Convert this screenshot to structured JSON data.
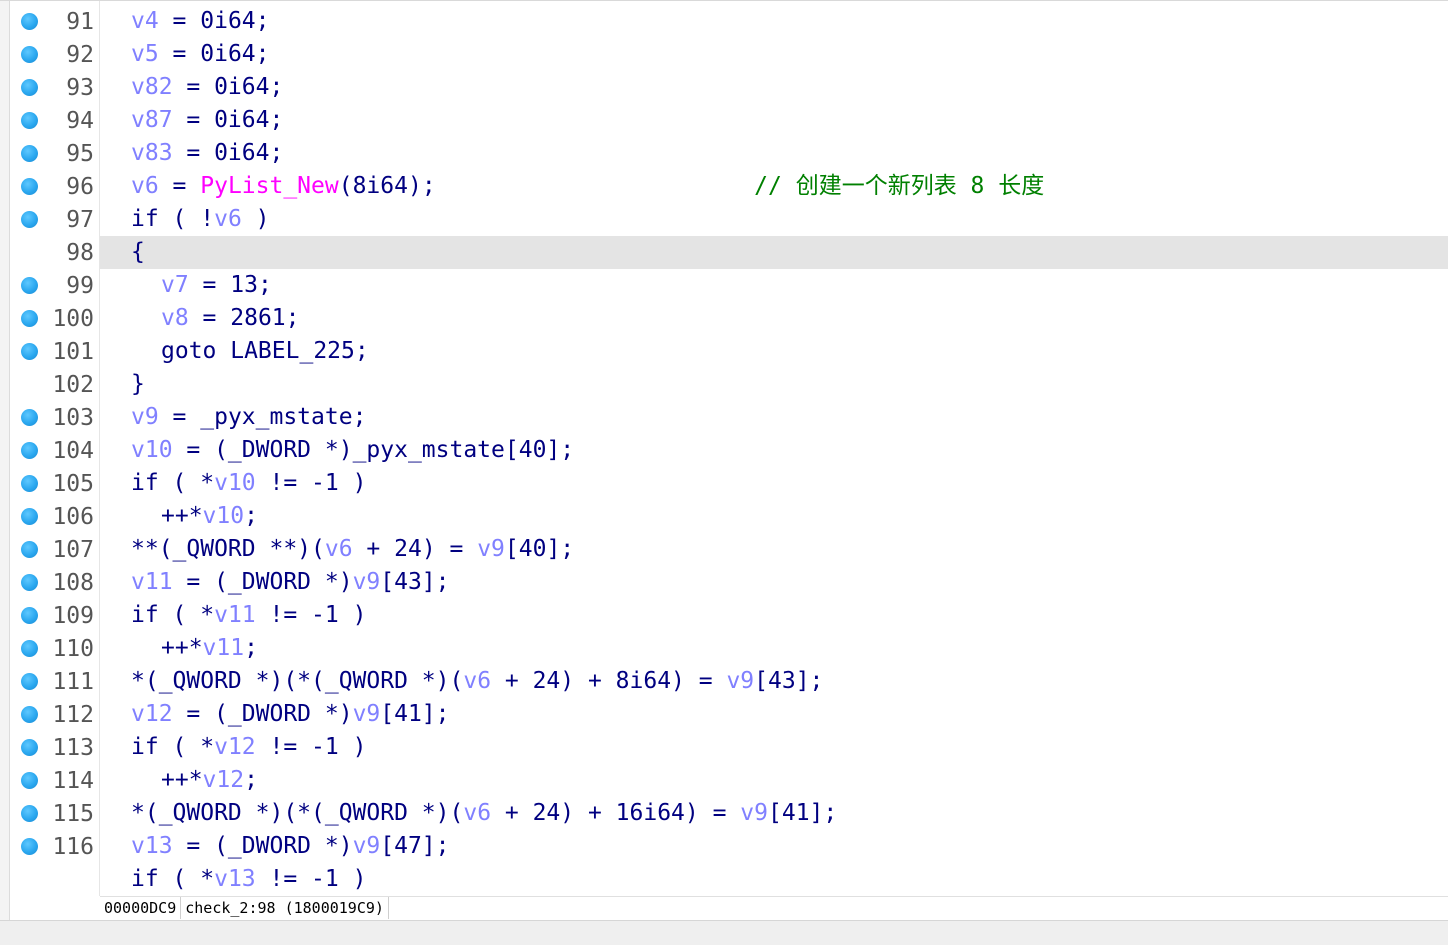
{
  "colors": {
    "variable": "#8080ff",
    "keyword": "#000080",
    "function": "#ff00ff",
    "comment": "#008000",
    "breakpoint": "#2aa7ef",
    "current_line_bg": "#e4e4e4"
  },
  "gutter": [
    {
      "num": "91",
      "bp": true
    },
    {
      "num": "92",
      "bp": true
    },
    {
      "num": "93",
      "bp": true
    },
    {
      "num": "94",
      "bp": true
    },
    {
      "num": "95",
      "bp": true
    },
    {
      "num": "96",
      "bp": true
    },
    {
      "num": "97",
      "bp": true
    },
    {
      "num": "98",
      "bp": false
    },
    {
      "num": "99",
      "bp": true
    },
    {
      "num": "100",
      "bp": true
    },
    {
      "num": "101",
      "bp": true
    },
    {
      "num": "102",
      "bp": false
    },
    {
      "num": "103",
      "bp": true
    },
    {
      "num": "104",
      "bp": true
    },
    {
      "num": "105",
      "bp": true
    },
    {
      "num": "106",
      "bp": true
    },
    {
      "num": "107",
      "bp": true
    },
    {
      "num": "108",
      "bp": true
    },
    {
      "num": "109",
      "bp": true
    },
    {
      "num": "110",
      "bp": true
    },
    {
      "num": "111",
      "bp": true
    },
    {
      "num": "112",
      "bp": true
    },
    {
      "num": "113",
      "bp": true
    },
    {
      "num": "114",
      "bp": true
    },
    {
      "num": "115",
      "bp": true
    },
    {
      "num": "116",
      "bp": true
    }
  ],
  "code": {
    "l91": {
      "v": "v4",
      "rest": " = 0i64;"
    },
    "l92": {
      "v": "v5",
      "rest": " = 0i64;"
    },
    "l93": {
      "v": "v82",
      "rest": " = 0i64;"
    },
    "l94": {
      "v": "v87",
      "rest": " = 0i64;"
    },
    "l95": {
      "v": "v83",
      "rest": " = 0i64;"
    },
    "l96": {
      "v": "v6",
      "eq": " = ",
      "fn": "PyList_New",
      "args": "(8i64);",
      "pad": "                       ",
      "comment": "// 创建一个新列表 8 长度"
    },
    "l97": {
      "kw": "if ( !",
      "v": "v6",
      "rest": " )"
    },
    "l98": {
      "text": "{"
    },
    "l99": {
      "v": "v7",
      "rest": " = 13;"
    },
    "l100": {
      "v": "v8",
      "rest": " = 2861;"
    },
    "l101": {
      "text": "goto LABEL_225;"
    },
    "l102": {
      "text": "}"
    },
    "l103": {
      "v": "v9",
      "rest": " = _pyx_mstate;"
    },
    "l104": {
      "v": "v10",
      "mid": " = (_DWORD *)",
      "rest": "_pyx_mstate[40];"
    },
    "l105": {
      "pre": "if ( *",
      "v": "v10",
      "rest": " != -1 )"
    },
    "l106": {
      "pre": "++*",
      "v": "v10",
      "rest": ";"
    },
    "l107": {
      "pre": "**(_QWORD **)(",
      "v": "v6",
      "mid": " + 24) = ",
      "v2": "v9",
      "rest": "[40];"
    },
    "l108": {
      "v": "v11",
      "mid": " = (_DWORD *)",
      "v2": "v9",
      "rest": "[43];"
    },
    "l109": {
      "pre": "if ( *",
      "v": "v11",
      "rest": " != -1 )"
    },
    "l110": {
      "pre": "++*",
      "v": "v11",
      "rest": ";"
    },
    "l111": {
      "pre": "*(_QWORD *)(*(_QWORD *)(",
      "v": "v6",
      "mid": " + 24) + 8i64) = ",
      "v2": "v9",
      "rest": "[43];"
    },
    "l112": {
      "v": "v12",
      "mid": " = (_DWORD *)",
      "v2": "v9",
      "rest": "[41];"
    },
    "l113": {
      "pre": "if ( *",
      "v": "v12",
      "rest": " != -1 )"
    },
    "l114": {
      "pre": "++*",
      "v": "v12",
      "rest": ";"
    },
    "l115": {
      "pre": "*(_QWORD *)(*(_QWORD *)(",
      "v": "v6",
      "mid": " + 24) + 16i64) = ",
      "v2": "v9",
      "rest": "[41];"
    },
    "l116": {
      "v": "v13",
      "mid": " = (_DWORD *)",
      "v2": "v9",
      "rest": "[47];"
    },
    "l117": {
      "pre": "if ( *",
      "v": "v13",
      "rest": " != -1 )"
    }
  },
  "status": {
    "offset": "00000DC9",
    "location": "check_2:98",
    "address": "(1800019C9)"
  }
}
